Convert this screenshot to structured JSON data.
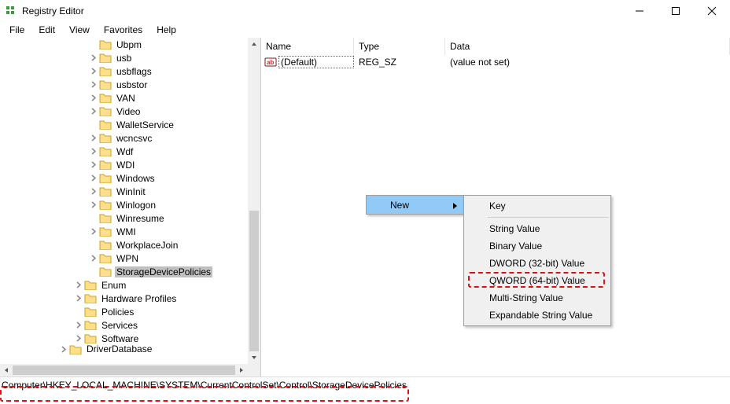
{
  "title": "Registry Editor",
  "menu": {
    "file": "File",
    "edit": "Edit",
    "view": "View",
    "favorites": "Favorites",
    "help": "Help"
  },
  "tree": [
    {
      "label": "Ubpm",
      "indent": 110,
      "expander": "none"
    },
    {
      "label": "usb",
      "indent": 110,
      "expander": "closed"
    },
    {
      "label": "usbflags",
      "indent": 110,
      "expander": "closed"
    },
    {
      "label": "usbstor",
      "indent": 110,
      "expander": "closed"
    },
    {
      "label": "VAN",
      "indent": 110,
      "expander": "closed"
    },
    {
      "label": "Video",
      "indent": 110,
      "expander": "closed"
    },
    {
      "label": "WalletService",
      "indent": 110,
      "expander": "none"
    },
    {
      "label": "wcncsvc",
      "indent": 110,
      "expander": "closed"
    },
    {
      "label": "Wdf",
      "indent": 110,
      "expander": "closed"
    },
    {
      "label": "WDI",
      "indent": 110,
      "expander": "closed"
    },
    {
      "label": "Windows",
      "indent": 110,
      "expander": "closed"
    },
    {
      "label": "WinInit",
      "indent": 110,
      "expander": "closed"
    },
    {
      "label": "Winlogon",
      "indent": 110,
      "expander": "closed"
    },
    {
      "label": "Winresume",
      "indent": 110,
      "expander": "none"
    },
    {
      "label": "WMI",
      "indent": 110,
      "expander": "closed"
    },
    {
      "label": "WorkplaceJoin",
      "indent": 110,
      "expander": "none"
    },
    {
      "label": "WPN",
      "indent": 110,
      "expander": "closed"
    },
    {
      "label": "StorageDevicePolicies",
      "indent": 110,
      "expander": "none",
      "selected": true
    },
    {
      "label": "Enum",
      "indent": 91,
      "expander": "closed"
    },
    {
      "label": "Hardware Profiles",
      "indent": 91,
      "expander": "closed"
    },
    {
      "label": "Policies",
      "indent": 91,
      "expander": "none"
    },
    {
      "label": "Services",
      "indent": 91,
      "expander": "closed"
    },
    {
      "label": "Software",
      "indent": 91,
      "expander": "closed"
    },
    {
      "label": "DriverDatabase",
      "indent": 72,
      "expander": "closed",
      "cut": true
    }
  ],
  "columns": {
    "name": "Name",
    "type": "Type",
    "data": "Data"
  },
  "values": [
    {
      "name": "(Default)",
      "type": "REG_SZ",
      "data": "(value not set)"
    }
  ],
  "ctx_parent": {
    "new": "New"
  },
  "ctx_sub": {
    "key": "Key",
    "string": "String Value",
    "binary": "Binary Value",
    "dword": "DWORD (32-bit) Value",
    "qword": "QWORD (64-bit) Value",
    "multi": "Multi-String Value",
    "expand": "Expandable String Value"
  },
  "status_path": "Computer\\HKEY_LOCAL_MACHINE\\SYSTEM\\CurrentControlSet\\Control\\StorageDevicePolicies"
}
